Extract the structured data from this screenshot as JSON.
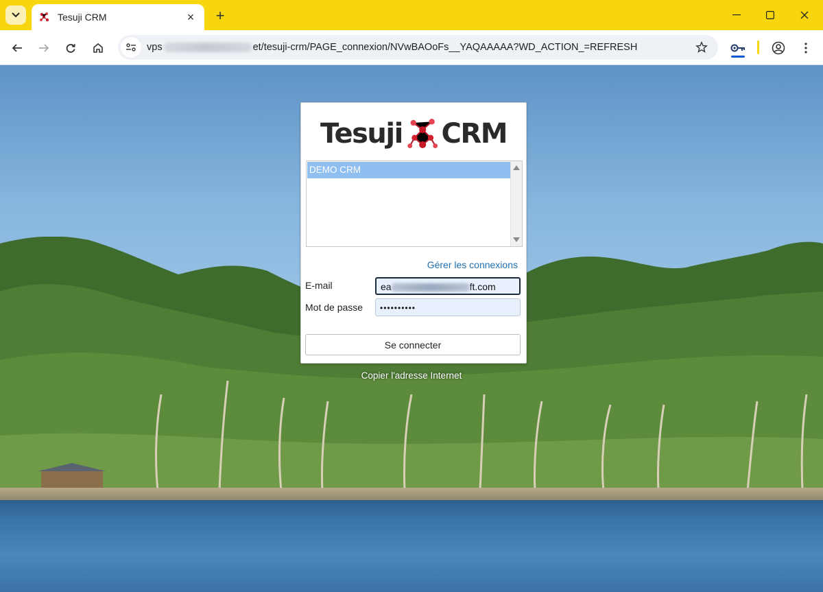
{
  "browser": {
    "tab": {
      "title": "Tesuji CRM"
    },
    "url": {
      "prefix": "vps",
      "suffix": "et/tesuji-crm/PAGE_connexion/NVwBAOoFs__YAQAAAAA?WD_ACTION_=REFRESH"
    },
    "colors": {
      "frame": "#f7d60e",
      "accent": "#0b57d0"
    }
  },
  "login": {
    "logo_left": "Tesuji",
    "logo_right": "CRM",
    "connections": [
      "DEMO CRM"
    ],
    "manage_link": "Gérer les connexions",
    "email_label": "E-mail",
    "email_value_start": "ea",
    "email_value_end": "ft.com",
    "password_label": "Mot de passe",
    "password_value": "••••••••••",
    "submit_label": "Se connecter"
  },
  "footer": {
    "copy_link": "Copier l'adresse Internet"
  }
}
